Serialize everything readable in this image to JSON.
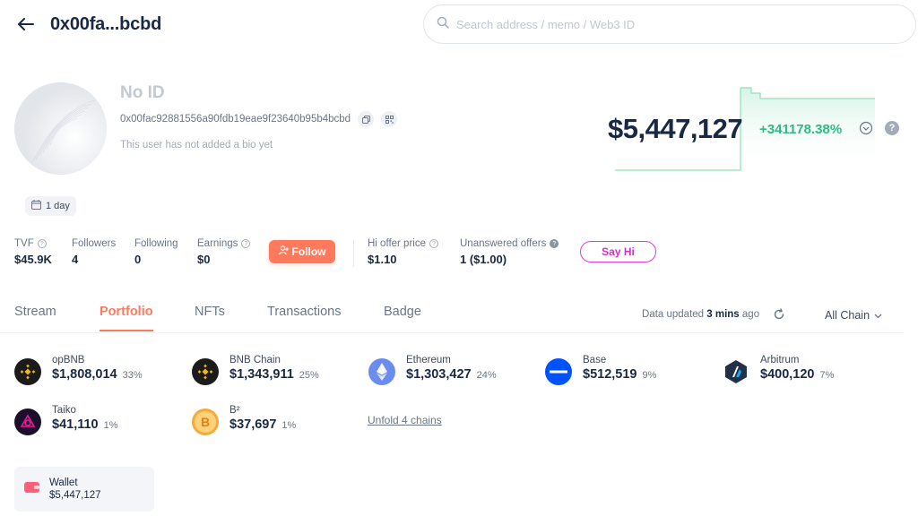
{
  "header": {
    "title": "0x00fa...bcbd",
    "search_placeholder": "Search address / memo / Web3 ID"
  },
  "profile": {
    "name": "No ID",
    "address": "0x00fac92881556a90fdb19eae9f23640b95b4bcbd",
    "bio": "This user has not added a bio yet",
    "age": "1 day"
  },
  "summary": {
    "balance": "$5,447,127",
    "change": "+341178.38%",
    "change_color": "#2fb984"
  },
  "stats": {
    "tvf_label": "TVF",
    "tvf_value": "$45.9K",
    "followers_label": "Followers",
    "followers_value": "4",
    "following_label": "Following",
    "following_value": "0",
    "earnings_label": "Earnings",
    "earnings_value": "$0",
    "follow_label": "Follow",
    "hi_offer_label": "Hi offer price",
    "hi_offer_value": "$1.10",
    "unanswered_label": "Unanswered offers",
    "unanswered_value": "1 ($1.00)",
    "sayhi_label": "Say Hi"
  },
  "tabs": [
    {
      "label": "Stream"
    },
    {
      "label": "Portfolio",
      "active": true
    },
    {
      "label": "NFTs"
    },
    {
      "label": "Transactions"
    },
    {
      "label": "Badge"
    }
  ],
  "data_updated": {
    "prefix": "Data updated",
    "time": "3 mins",
    "suffix": "ago"
  },
  "chain_filter": "All Chain",
  "chains": [
    {
      "name": "opBNB",
      "amount": "$1,808,014",
      "pct": "33%",
      "icon": "bnb-icon"
    },
    {
      "name": "BNB Chain",
      "amount": "$1,343,911",
      "pct": "25%",
      "icon": "bnb-icon"
    },
    {
      "name": "Ethereum",
      "amount": "$1,303,427",
      "pct": "24%",
      "icon": "ethereum-icon"
    },
    {
      "name": "Base",
      "amount": "$512,519",
      "pct": "9%",
      "icon": "base-icon"
    },
    {
      "name": "Arbitrum",
      "amount": "$400,120",
      "pct": "7%",
      "icon": "arbitrum-icon"
    },
    {
      "name": "Taiko",
      "amount": "$41,110",
      "pct": "1%",
      "icon": "taiko-icon"
    },
    {
      "name": "B²",
      "amount": "$37,697",
      "pct": "1%",
      "icon": "b2-icon"
    }
  ],
  "unfold_label": "Unfold 4 chains",
  "wallet": {
    "name": "Wallet",
    "value": "$5,447,127"
  },
  "colors": {
    "accent": "#ff7a5c",
    "say_hi": "#e33bd6",
    "positive": "#2fb984"
  }
}
